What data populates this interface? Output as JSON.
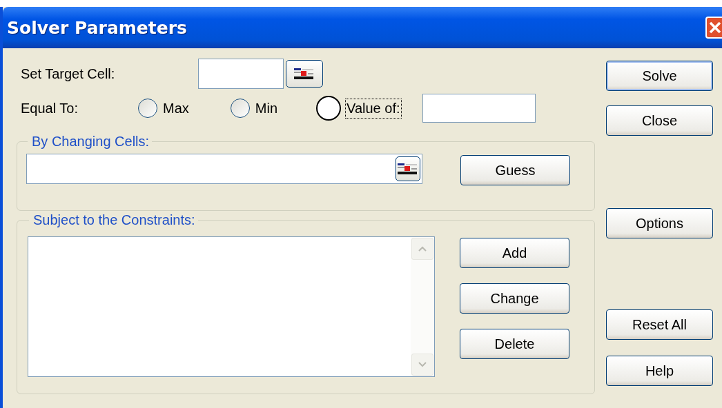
{
  "window": {
    "title": "Solver Parameters"
  },
  "target_cell": {
    "label": "Set Target Cell:"
  },
  "equal_to": {
    "label": "Equal To:",
    "options": [
      {
        "label": "Max",
        "selected": false,
        "focused": false
      },
      {
        "label": "Min",
        "selected": false,
        "focused": false
      },
      {
        "label": "Value of:",
        "selected": false,
        "focused": true
      }
    ]
  },
  "changing_cells": {
    "label": "By Changing Cells:",
    "button": "Guess"
  },
  "constraints": {
    "label": "Subject to the Constraints:",
    "buttons": [
      "Add",
      "Change",
      "Delete"
    ]
  },
  "side_buttons": {
    "top": [
      "Solve",
      "Close"
    ],
    "middle": [
      "Options"
    ],
    "bottom": [
      "Reset All",
      "Help"
    ]
  }
}
